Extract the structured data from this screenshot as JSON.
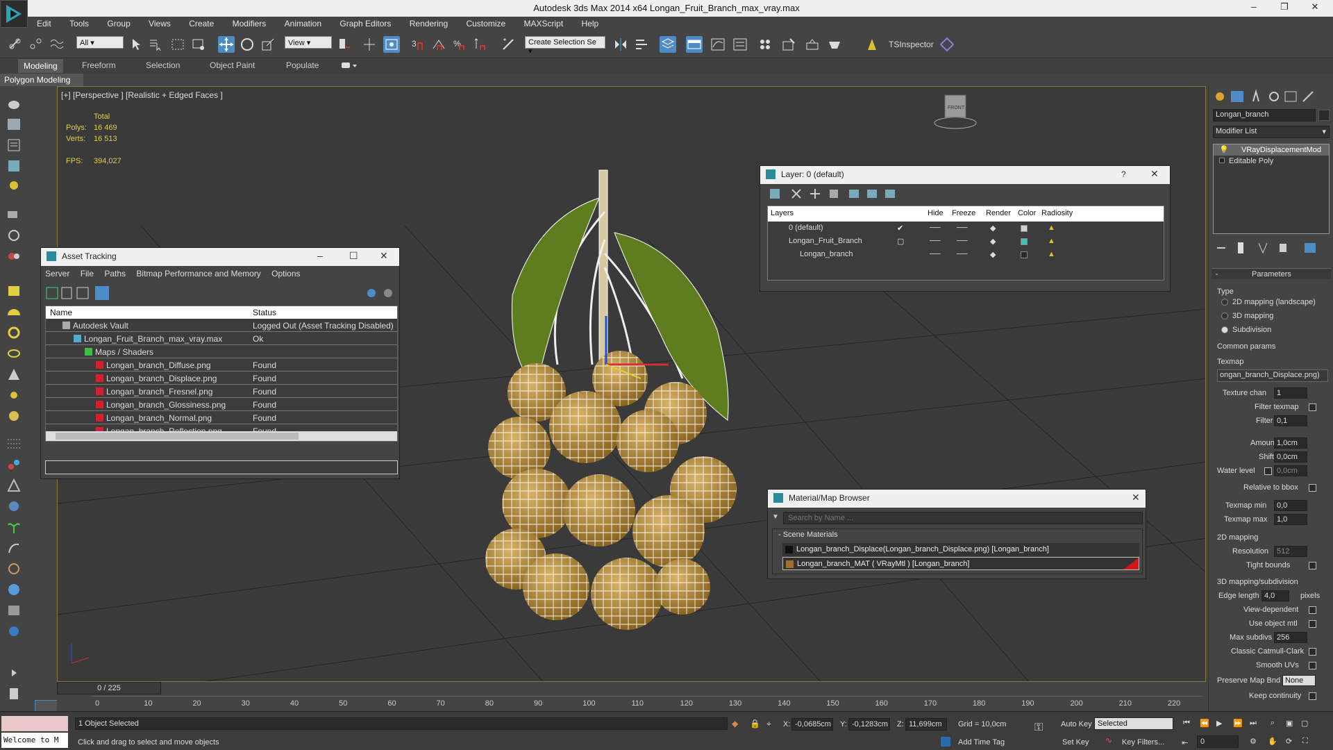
{
  "window": {
    "title": "Autodesk 3ds Max  2014 x64     Longan_Fruit_Branch_max_vray.max"
  },
  "menu": [
    "Edit",
    "Tools",
    "Group",
    "Views",
    "Create",
    "Modifiers",
    "Animation",
    "Graph Editors",
    "Rendering",
    "Customize",
    "MAXScript",
    "Help"
  ],
  "toolbar": {
    "filter_value": "All",
    "refcoord_value": "View",
    "selset_value": "Create Selection Se",
    "tsinspector_label": "TSInspector"
  },
  "ribbon": {
    "tabs": [
      "Modeling",
      "Freeform",
      "Selection",
      "Object Paint",
      "Populate"
    ],
    "panel_label": "Polygon Modeling"
  },
  "viewport": {
    "label": "[+] [Perspective ] [Realistic + Edged Faces ]",
    "stats": {
      "total_label": "Total",
      "polys_label": "Polys:",
      "polys_value": "16 469",
      "verts_label": "Verts:",
      "verts_value": "16 513",
      "fps_label": "FPS:",
      "fps_value": "394,027"
    },
    "cube_label": "FRONT"
  },
  "asset_tracking": {
    "title": "Asset Tracking",
    "menu": [
      "Server",
      "File",
      "Paths",
      "Bitmap Performance and Memory",
      "Options"
    ],
    "columns": [
      "Name",
      "Status"
    ],
    "rows": [
      {
        "name": "Autodesk Vault",
        "status": "Logged Out (Asset Tracking Disabled)"
      },
      {
        "name": "Longan_Fruit_Branch_max_vray.max",
        "status": "Ok"
      },
      {
        "name": "Maps / Shaders",
        "status": ""
      },
      {
        "name": "Longan_branch_Diffuse.png",
        "status": "Found"
      },
      {
        "name": "Longan_branch_Displace.png",
        "status": "Found"
      },
      {
        "name": "Longan_branch_Fresnel.png",
        "status": "Found"
      },
      {
        "name": "Longan_branch_Glossiness.png",
        "status": "Found"
      },
      {
        "name": "Longan_branch_Normal.png",
        "status": "Found"
      },
      {
        "name": "Longan_branch_Reflection.png",
        "status": "Found"
      }
    ]
  },
  "layer": {
    "title": "Layer: 0 (default)",
    "help_label": "?",
    "columns": [
      "Layers",
      "Hide",
      "Freeze",
      "Render",
      "Color",
      "Radiosity"
    ],
    "rows": [
      {
        "name": "0 (default)",
        "color": "#d0d0d0"
      },
      {
        "name": "Longan_Fruit_Branch",
        "color": "#40c0b0"
      },
      {
        "name": "Longan_branch",
        "color": "#2a2a2a"
      }
    ]
  },
  "material": {
    "title": "Material/Map Browser",
    "search_placeholder": "Search by Name ...",
    "section": "- Scene Materials",
    "items": [
      "Longan_branch_Displace(Longan_branch_Displace.png) [Longan_branch]",
      "Longan_branch_MAT  ( VRayMtl )  [Longan_branch]"
    ]
  },
  "command_panel": {
    "object_name": "Longan_branch",
    "modifier_list": "Modifier List",
    "stack": [
      "VRayDisplacementMod",
      "Editable Poly"
    ],
    "parameters_title": "Parameters",
    "type_label": "Type",
    "type_options": [
      "2D mapping (landscape)",
      "3D mapping",
      "Subdivision"
    ],
    "common_params": "Common params",
    "texmap_label": "Texmap",
    "texmap_value": "ongan_branch_Displace.png)",
    "texture_chan_label": "Texture chan",
    "texture_chan_value": "1",
    "filter_texmap_label": "Filter texmap",
    "filter_blur_label": "Filter blur",
    "filter_blur_value": "0,1",
    "amount_label": "Amount",
    "amount_value": "1,0cm",
    "shift_label": "Shift",
    "shift_value": "0,0cm",
    "water_label": "Water level",
    "water_value": "0,0cm",
    "relative_label": "Relative to bbox",
    "texmin_label": "Texmap min",
    "texmin_value": "0,0",
    "texmax_label": "Texmap max",
    "texmax_value": "1,0",
    "map2d_label": "2D mapping",
    "resolution_label": "Resolution",
    "resolution_value": "512",
    "tight_label": "Tight bounds",
    "map3d_label": "3D mapping/subdivision",
    "edge_label": "Edge length",
    "edge_value": "4,0",
    "pixels_label": "pixels",
    "viewdep_label": "View-dependent",
    "useobj_label": "Use object mtl",
    "maxsub_label": "Max subdivs",
    "maxsub_value": "256",
    "catmull_label": "Classic Catmull-Clark",
    "smooth_label": "Smooth UVs",
    "preserve_label": "Preserve Map Bnd",
    "preserve_value": "None",
    "keep_label": "Keep continuity"
  },
  "timeline": {
    "frame": "0 / 225",
    "ticks": [
      "0",
      "10",
      "20",
      "30",
      "40",
      "50",
      "60",
      "70",
      "80",
      "90",
      "100",
      "110",
      "120",
      "130",
      "140",
      "150",
      "160",
      "170",
      "180",
      "190",
      "200",
      "210",
      "220"
    ]
  },
  "status": {
    "welcome": "Welcome to M",
    "selected": "1 Object Selected",
    "prompt": "Click and drag to select and move objects",
    "x_label": "X:",
    "x_value": "-0,0685cm",
    "y_label": "Y:",
    "y_value": "-0,1283cm",
    "z_label": "Z:",
    "z_value": "11,699cm",
    "grid": "Grid = 10,0cm",
    "add_time_tag": "Add Time Tag",
    "auto_key": "Auto Key",
    "set_key": "Set Key",
    "selected_dropdown": "Selected",
    "key_filters": "Key Filters...",
    "frame_input": "0"
  }
}
